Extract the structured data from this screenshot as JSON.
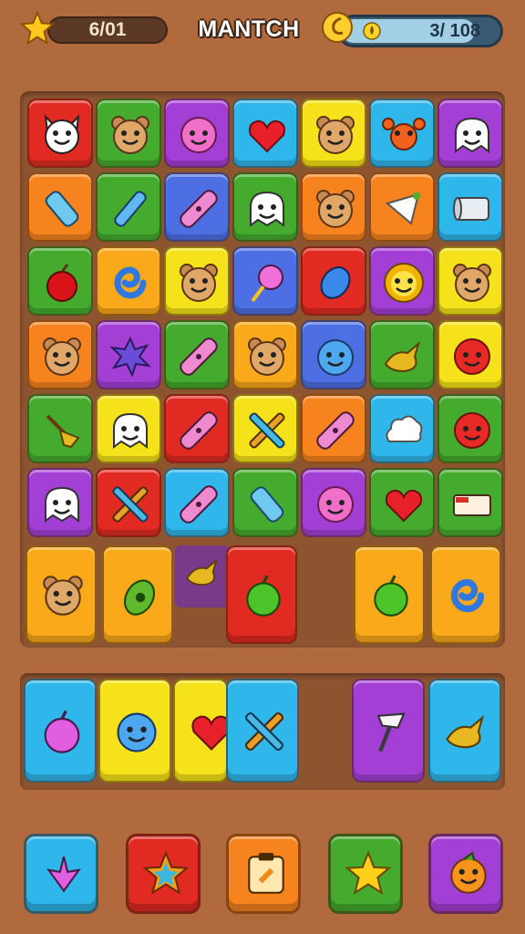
{
  "header": {
    "score": "6/01",
    "title": "MANTCH",
    "progress_text": "3/ 108",
    "progress_fraction": 0.85
  },
  "icons": {
    "top_left": "star-icon",
    "top_right": "coin-icon"
  },
  "colors": {
    "background": "#b06a3e",
    "board": "#8d5430",
    "red": "#e02a22",
    "green": "#44ab2e",
    "purple": "#a43fd6",
    "cyan": "#2fb6ea",
    "yellow": "#f6e21a",
    "orange": "#f7831f",
    "blue": "#4d6fe3"
  },
  "board": {
    "rows": [
      [
        {
          "color": "red",
          "icon": "cat-face"
        },
        {
          "color": "green",
          "icon": "bear-face"
        },
        {
          "color": "purple",
          "icon": "pink-blob-face"
        },
        {
          "color": "cyan",
          "icon": "heart"
        },
        {
          "color": "yellow",
          "icon": "bear-face"
        },
        {
          "color": "cyan",
          "icon": "crab"
        },
        {
          "color": "purple",
          "icon": "ghost-face"
        }
      ],
      [
        {
          "color": "orange",
          "icon": "bottle"
        },
        {
          "color": "green",
          "icon": "pencil"
        },
        {
          "color": "blue",
          "icon": "bandage"
        },
        {
          "color": "green",
          "icon": "ghost-face"
        },
        {
          "color": "orange",
          "icon": "bear-face"
        },
        {
          "color": "orange",
          "icon": "napkin"
        },
        {
          "color": "cyan",
          "icon": "paper-roll"
        }
      ],
      [
        {
          "color": "green",
          "icon": "apple"
        },
        {
          "color": "gold",
          "icon": "swirl"
        },
        {
          "color": "yellow",
          "icon": "bear-face"
        },
        {
          "color": "blue",
          "icon": "lollipop"
        },
        {
          "color": "red",
          "icon": "blue-gem"
        },
        {
          "color": "purple",
          "icon": "lion-face"
        },
        {
          "color": "yellow",
          "icon": "bear-face"
        }
      ],
      [
        {
          "color": "orange",
          "icon": "bear-face"
        },
        {
          "color": "purple",
          "icon": "splat"
        },
        {
          "color": "green",
          "icon": "bandage"
        },
        {
          "color": "gold",
          "icon": "bear-face"
        },
        {
          "color": "blue",
          "icon": "blob-face"
        },
        {
          "color": "green",
          "icon": "bird"
        },
        {
          "color": "yellow",
          "icon": "red-ball-face"
        }
      ],
      [
        {
          "color": "green",
          "icon": "broom"
        },
        {
          "color": "yellow",
          "icon": "ghost-face"
        },
        {
          "color": "red",
          "icon": "bandage"
        },
        {
          "color": "yellow",
          "icon": "crossed-tools"
        },
        {
          "color": "orange",
          "icon": "bandage"
        },
        {
          "color": "cyan",
          "icon": "cloud"
        },
        {
          "color": "green",
          "icon": "red-ball-face"
        }
      ],
      [
        {
          "color": "purple",
          "icon": "ghost-face"
        },
        {
          "color": "red",
          "icon": "crossed-tools"
        },
        {
          "color": "cyan",
          "icon": "bandage"
        },
        {
          "color": "green",
          "icon": "bottle"
        },
        {
          "color": "purple",
          "icon": "pink-blob-face"
        },
        {
          "color": "green",
          "icon": "heart"
        },
        {
          "color": "green",
          "icon": "box"
        }
      ]
    ]
  },
  "big_row": [
    {
      "color": "gold",
      "icon": "bear-face"
    },
    {
      "color": "gold",
      "icon": "green-pear"
    },
    {
      "color": "purple",
      "icon": "bird"
    },
    {
      "color": "red",
      "icon": "green-apple"
    },
    {
      "color": "gold",
      "icon": "green-apple"
    },
    {
      "color": "gold",
      "icon": "swirl"
    }
  ],
  "tray": [
    {
      "color": "cyan",
      "icon": "pink-apple"
    },
    {
      "color": "yellow",
      "icon": "blob-face"
    },
    {
      "color": "yellow",
      "icon": "heart"
    },
    {
      "color": "cyan",
      "icon": "crossed-tools"
    },
    {
      "color": "purple",
      "icon": "axe"
    },
    {
      "color": "cyan",
      "icon": "bird"
    }
  ],
  "boosters": [
    {
      "color": "cyan",
      "icon": "heart-arrow"
    },
    {
      "color": "red",
      "icon": "rainbow-star"
    },
    {
      "color": "orange",
      "icon": "clipboard"
    },
    {
      "color": "green",
      "icon": "star"
    },
    {
      "color": "purple",
      "icon": "orange-fruit-face"
    }
  ]
}
